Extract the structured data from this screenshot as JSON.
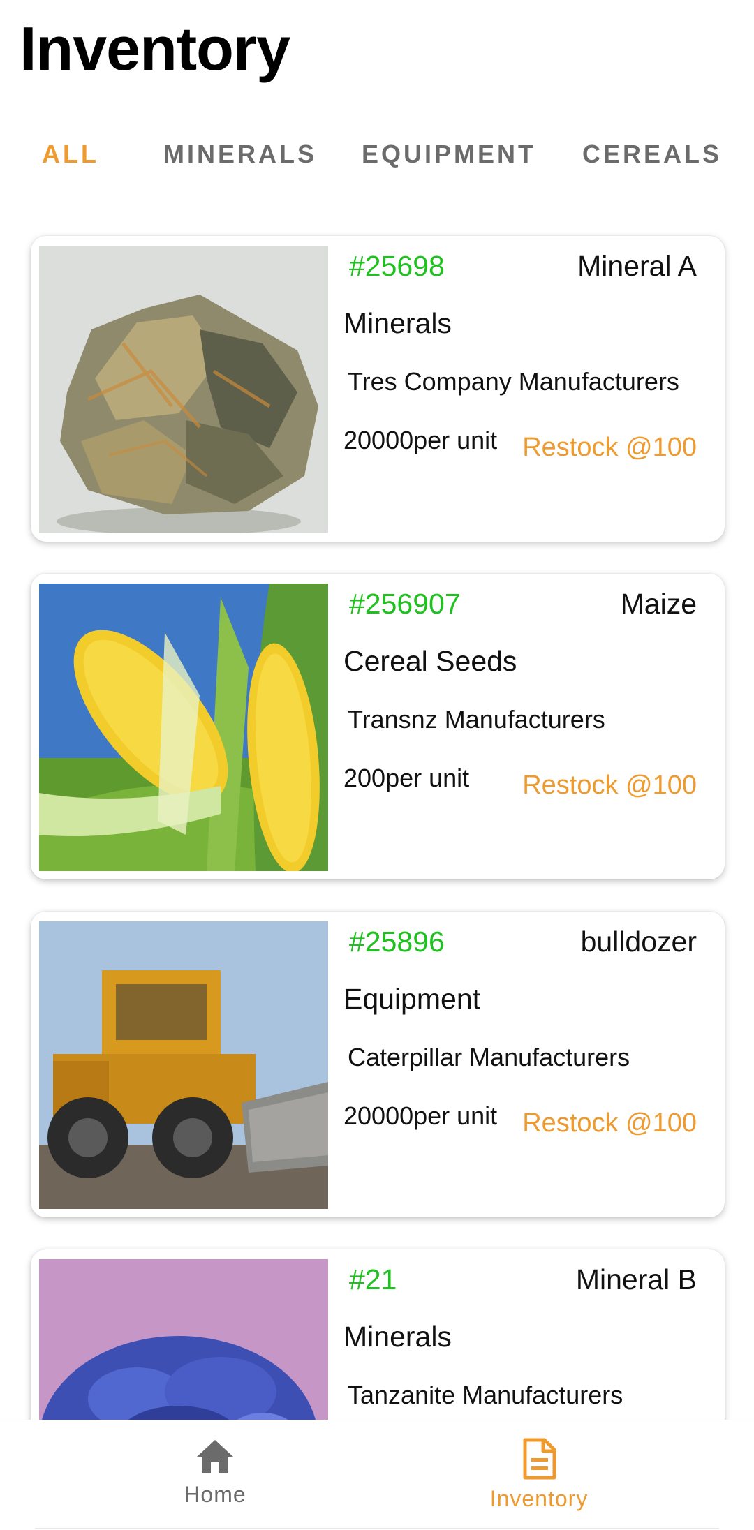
{
  "header": {
    "title": "Inventory"
  },
  "tabs": [
    {
      "label": "ALL",
      "active": true
    },
    {
      "label": "MINERALS",
      "active": false
    },
    {
      "label": "EQUIPMENT",
      "active": false
    },
    {
      "label": "CEREALS",
      "active": false
    }
  ],
  "items": [
    {
      "code": "#25698",
      "name": "Mineral A",
      "category": "Minerals",
      "manufacturer": "Tres Company Manufacturers",
      "price": "20000per unit",
      "restock": "Restock @100",
      "image": "mineral-rock-image"
    },
    {
      "code": "#256907",
      "name": "Maize",
      "category": "Cereal Seeds",
      "manufacturer": "Transnz Manufacturers",
      "price": "200per unit",
      "restock": "Restock @100",
      "image": "maize-cobs-image"
    },
    {
      "code": "#25896",
      "name": "bulldozer",
      "category": "Equipment",
      "manufacturer": "Caterpillar Manufacturers",
      "price": "20000per unit",
      "restock": "Restock @100",
      "image": "bulldozer-image"
    },
    {
      "code": "#21",
      "name": "Mineral B",
      "category": "Minerals",
      "manufacturer": "Tanzanite Manufacturers",
      "price": "",
      "restock": "",
      "image": "blue-crystal-image"
    }
  ],
  "bottom_nav": [
    {
      "label": "Home",
      "icon": "home-icon",
      "active": false
    },
    {
      "label": "Inventory",
      "icon": "document-icon",
      "active": true
    }
  ],
  "colors": {
    "accent": "#ef9a2e",
    "code_green": "#1fc11f",
    "tab_inactive": "#6b6b6b"
  }
}
